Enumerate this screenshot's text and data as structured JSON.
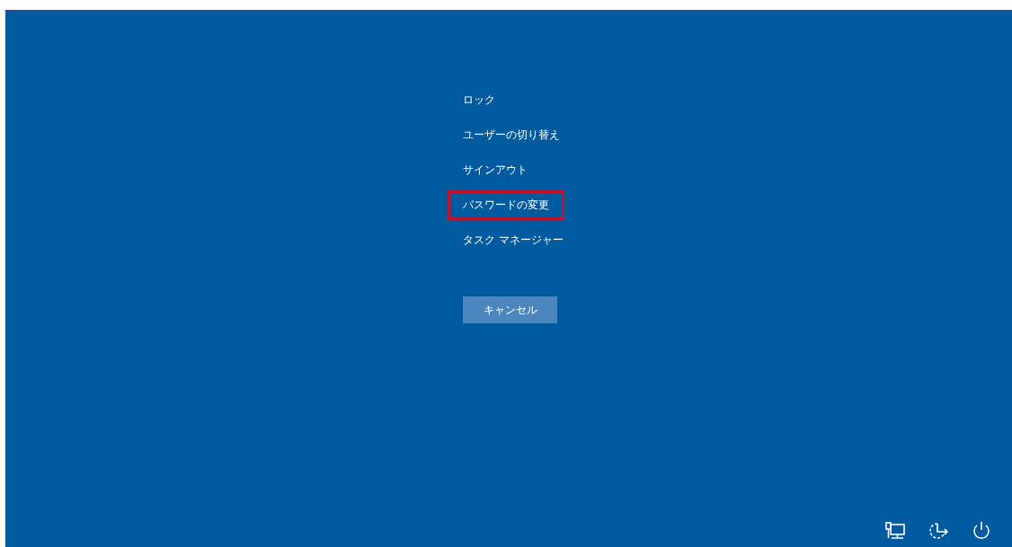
{
  "menu": [
    {
      "label": "ロック",
      "highlighted": false
    },
    {
      "label": "ユーザーの切り替え",
      "highlighted": false
    },
    {
      "label": "サインアウト",
      "highlighted": false
    },
    {
      "label": "パスワードの変更",
      "highlighted": true
    },
    {
      "label": "タスク マネージャー",
      "highlighted": false
    }
  ],
  "cancel_button": "キャンセル",
  "tray_icons": [
    {
      "kind": "network"
    },
    {
      "kind": "accessibility"
    },
    {
      "kind": "power"
    }
  ]
}
